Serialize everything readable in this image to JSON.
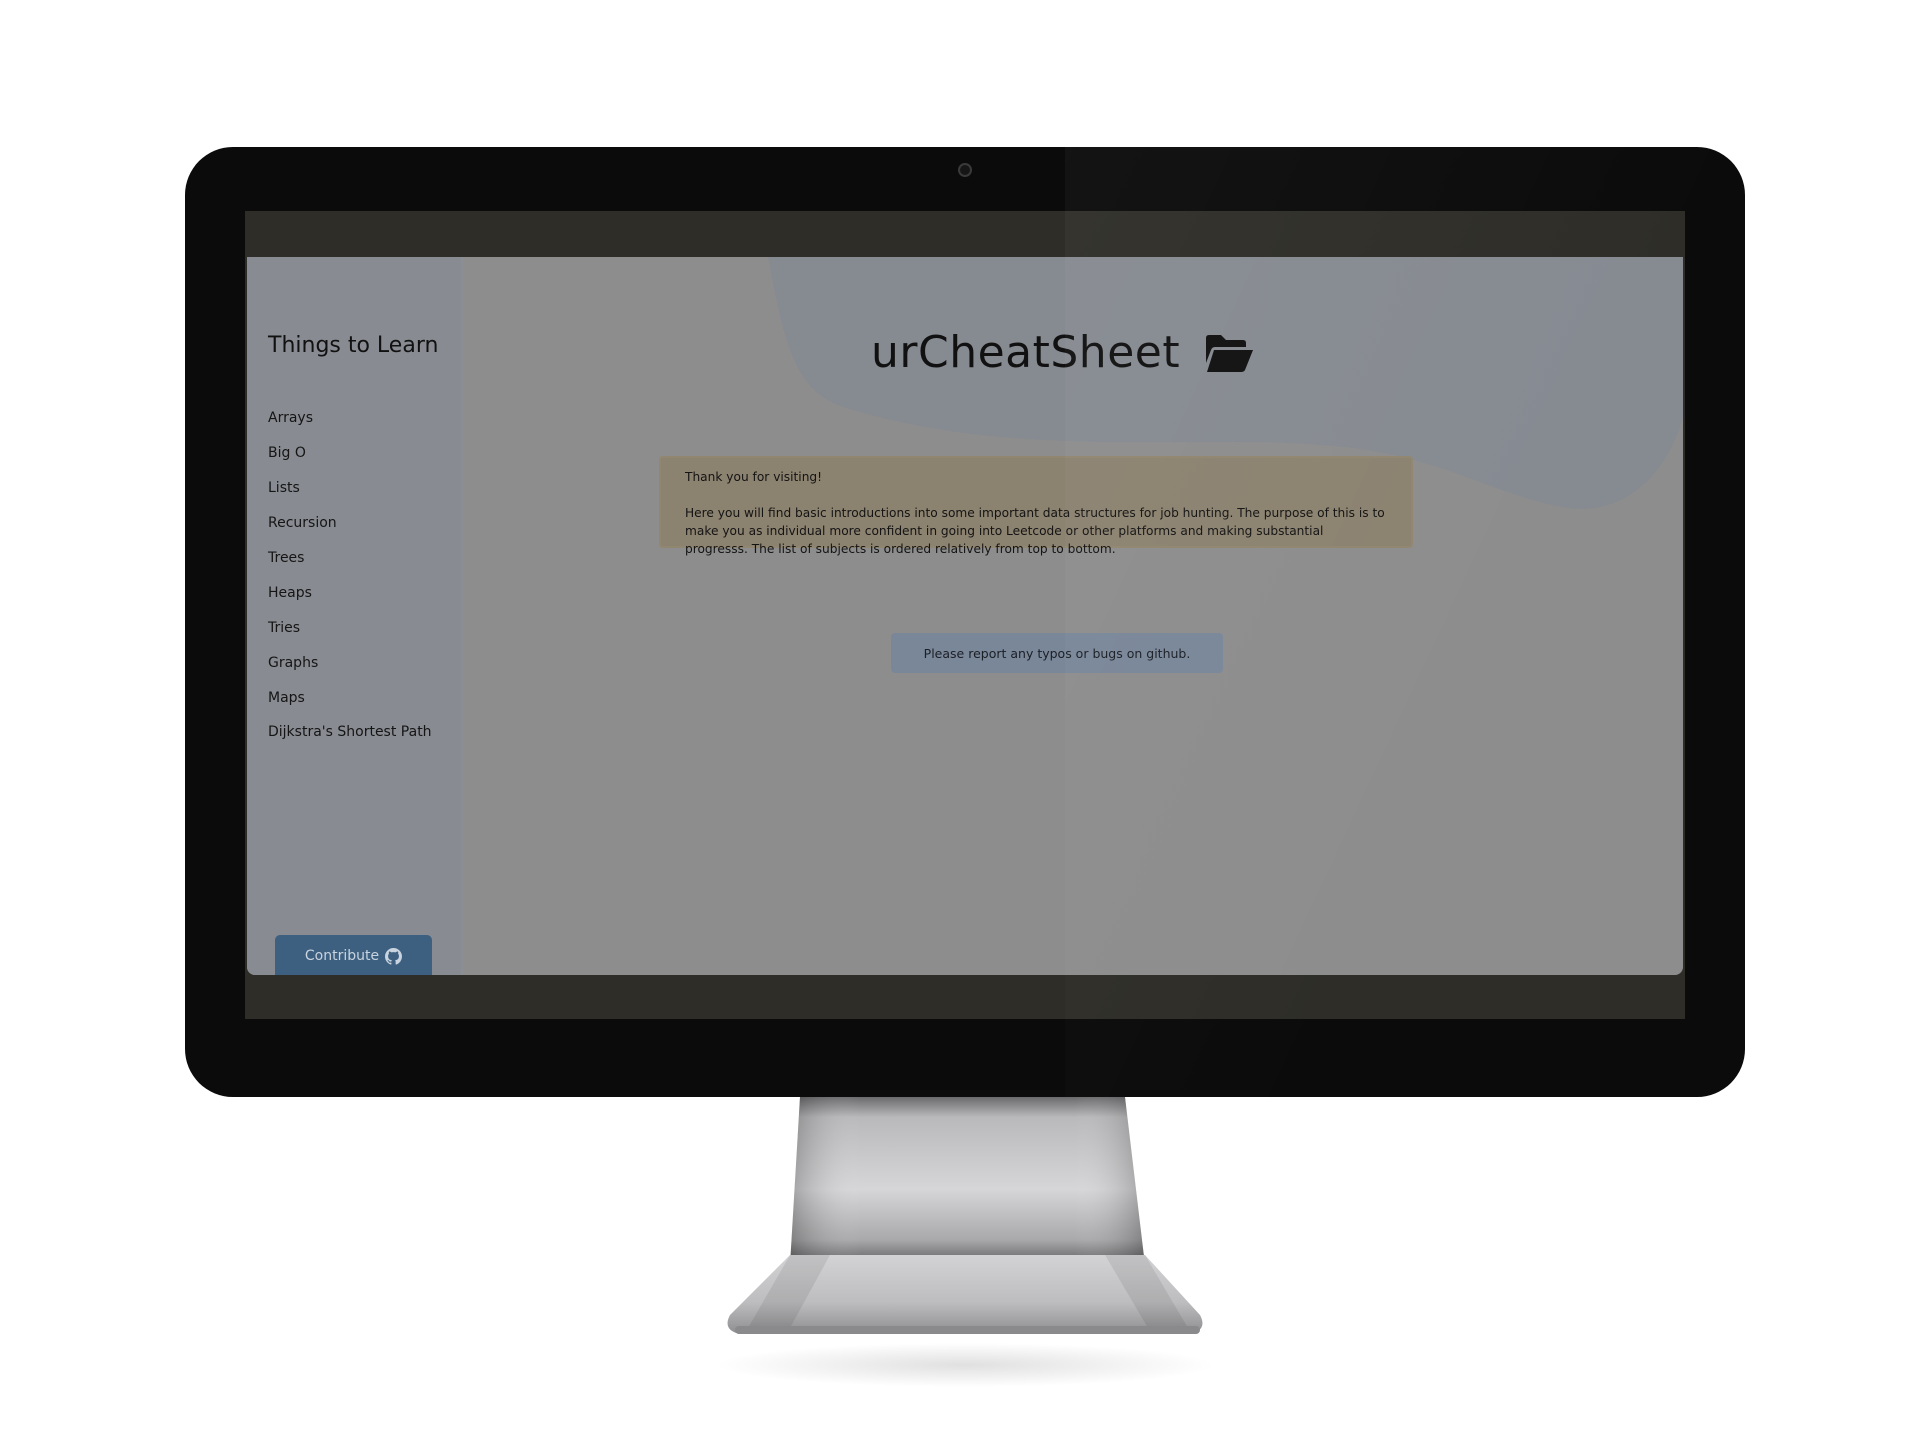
{
  "sidebar": {
    "title": "Things to Learn",
    "items": [
      {
        "label": "Arrays"
      },
      {
        "label": "Big O"
      },
      {
        "label": "Lists"
      },
      {
        "label": "Recursion"
      },
      {
        "label": "Trees"
      },
      {
        "label": "Heaps"
      },
      {
        "label": "Tries"
      },
      {
        "label": "Graphs"
      },
      {
        "label": "Maps"
      },
      {
        "label": "Dijkstra's Shortest Path"
      }
    ],
    "contribute_label": "Contribute",
    "contribute_icon": "github-icon"
  },
  "header": {
    "title": "urCheatSheet",
    "icon": "folder-open-icon"
  },
  "notice": {
    "greeting": "Thank you for visiting!",
    "body": "Here you will find basic introductions into some important data structures for job hunting. The purpose of this is to make you as individual more confident in going into Leetcode or other platforms and making substantial progresss. The list of subjects is ordered relatively from top to bottom."
  },
  "report": {
    "text": "Please report any typos or bugs on github."
  },
  "colors": {
    "overlay": "#8d8d8d",
    "sidebar": "#888b91",
    "notice_bg": "#8c8270",
    "report_bg": "#7a8799",
    "contribute_bg": "#3d5f80",
    "blob": "#868a91"
  }
}
